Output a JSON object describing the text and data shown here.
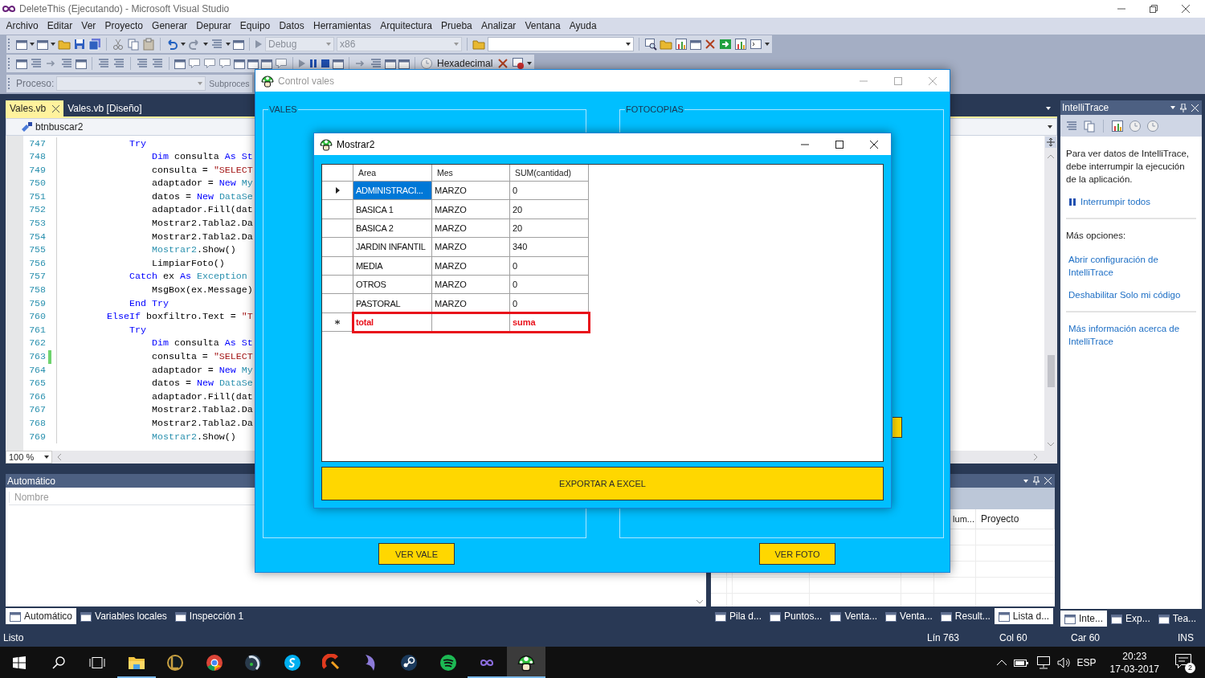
{
  "window": {
    "title": "DeleteThis (Ejecutando) - Microsoft Visual Studio"
  },
  "menu": [
    "Archivo",
    "Editar",
    "Ver",
    "Proyecto",
    "Generar",
    "Depurar",
    "Equipo",
    "Datos",
    "Herramientas",
    "Arquitectura",
    "Prueba",
    "Analizar",
    "Ventana",
    "Ayuda"
  ],
  "toolbar": {
    "configuration": "Debug",
    "platform": "x86",
    "display_format": "Hexadecimal"
  },
  "debug_location": {
    "process_label": "Proceso:",
    "thread_label": "Subproces"
  },
  "editor": {
    "tabs": [
      {
        "label": "Vales.vb",
        "selected": true
      },
      {
        "label": "Vales.vb [Diseño]",
        "selected": false
      }
    ],
    "member": "btnbuscar2",
    "lines": [
      {
        "number": "747",
        "modified": false,
        "tokens": [
          {
            "text": "            Try",
            "kind": "keyword"
          }
        ]
      },
      {
        "number": "748",
        "modified": false,
        "tokens": [
          {
            "text": "                Dim",
            "kind": "keyword"
          },
          {
            "text": " consulta ",
            "kind": "plain"
          },
          {
            "text": "As St",
            "kind": "keyword"
          }
        ]
      },
      {
        "number": "749",
        "modified": false,
        "tokens": [
          {
            "text": "                consulta = ",
            "kind": "plain"
          },
          {
            "text": "\"SELECT",
            "kind": "string"
          }
        ]
      },
      {
        "number": "750",
        "modified": false,
        "tokens": [
          {
            "text": "                adaptador = ",
            "kind": "plain"
          },
          {
            "text": "New ",
            "kind": "keyword"
          },
          {
            "text": "My",
            "kind": "type"
          }
        ]
      },
      {
        "number": "751",
        "modified": false,
        "tokens": [
          {
            "text": "                datos = ",
            "kind": "plain"
          },
          {
            "text": "New ",
            "kind": "keyword"
          },
          {
            "text": "DataSe",
            "kind": "type"
          }
        ]
      },
      {
        "number": "752",
        "modified": false,
        "tokens": [
          {
            "text": "                adaptador.Fill(dat",
            "kind": "plain"
          }
        ]
      },
      {
        "number": "753",
        "modified": false,
        "tokens": [
          {
            "text": "                Mostrar2.Tabla2.Da",
            "kind": "plain"
          }
        ]
      },
      {
        "number": "754",
        "modified": false,
        "tokens": [
          {
            "text": "                Mostrar2.Tabla2.Da",
            "kind": "plain"
          }
        ]
      },
      {
        "number": "755",
        "modified": false,
        "tokens": [
          {
            "text": "                Mostrar2",
            "kind": "type"
          },
          {
            "text": ".Show()",
            "kind": "plain"
          }
        ]
      },
      {
        "number": "756",
        "modified": false,
        "tokens": [
          {
            "text": "                LimpiarFoto()",
            "kind": "plain"
          }
        ]
      },
      {
        "number": "757",
        "modified": false,
        "tokens": [
          {
            "text": "            Catch",
            "kind": "keyword"
          },
          {
            "text": " ex ",
            "kind": "plain"
          },
          {
            "text": "As ",
            "kind": "keyword"
          },
          {
            "text": "Exception",
            "kind": "type"
          }
        ]
      },
      {
        "number": "758",
        "modified": false,
        "tokens": [
          {
            "text": "                MsgBox(ex.Message)",
            "kind": "plain"
          }
        ]
      },
      {
        "number": "759",
        "modified": false,
        "tokens": [
          {
            "text": "            End Try",
            "kind": "keyword"
          }
        ]
      },
      {
        "number": "760",
        "modified": false,
        "tokens": [
          {
            "text": "        ElseIf",
            "kind": "keyword"
          },
          {
            "text": " boxfiltro.Text = ",
            "kind": "plain"
          },
          {
            "text": "\"T",
            "kind": "string"
          }
        ]
      },
      {
        "number": "761",
        "modified": false,
        "tokens": [
          {
            "text": "            Try",
            "kind": "keyword"
          }
        ]
      },
      {
        "number": "762",
        "modified": false,
        "tokens": [
          {
            "text": "                Dim",
            "kind": "keyword"
          },
          {
            "text": " consulta ",
            "kind": "plain"
          },
          {
            "text": "As St",
            "kind": "keyword"
          }
        ]
      },
      {
        "number": "763",
        "modified": true,
        "tokens": [
          {
            "text": "                consulta = ",
            "kind": "plain"
          },
          {
            "text": "\"SELECT",
            "kind": "string"
          }
        ]
      },
      {
        "number": "764",
        "modified": false,
        "tokens": [
          {
            "text": "                adaptador = ",
            "kind": "plain"
          },
          {
            "text": "New ",
            "kind": "keyword"
          },
          {
            "text": "My",
            "kind": "type"
          }
        ]
      },
      {
        "number": "765",
        "modified": false,
        "tokens": [
          {
            "text": "                datos = ",
            "kind": "plain"
          },
          {
            "text": "New ",
            "kind": "keyword"
          },
          {
            "text": "DataSe",
            "kind": "type"
          }
        ]
      },
      {
        "number": "766",
        "modified": false,
        "tokens": [
          {
            "text": "                adaptador.Fill(dat",
            "kind": "plain"
          }
        ]
      },
      {
        "number": "767",
        "modified": false,
        "tokens": [
          {
            "text": "                Mostrar2.Tabla2.Da",
            "kind": "plain"
          }
        ]
      },
      {
        "number": "768",
        "modified": false,
        "tokens": [
          {
            "text": "                Mostrar2.Tabla2.Da",
            "kind": "plain"
          }
        ]
      },
      {
        "number": "769",
        "modified": false,
        "tokens": [
          {
            "text": "                Mostrar2",
            "kind": "type"
          },
          {
            "text": ".Show()",
            "kind": "plain"
          }
        ]
      }
    ],
    "zoom": "100 %"
  },
  "intellitrace": {
    "title": "IntelliTrace",
    "message": "Para ver datos de IntelliTrace, debe interrumpir la ejecución de la aplicación.",
    "break_link": "Interrumpir todos",
    "more_label": "Más opciones:",
    "links": [
      "Abrir configuración de IntelliTrace",
      "Deshabilitar Solo mi código"
    ],
    "info_link": "Más información acerca de IntelliTrace",
    "tabs": [
      {
        "label": "Inte...",
        "selected": true
      },
      {
        "label": "Exp...",
        "selected": false
      },
      {
        "label": "Tea...",
        "selected": false
      }
    ]
  },
  "autos": {
    "title": "Automático",
    "column": "Nombre",
    "tabs": [
      {
        "label": "Automático",
        "selected": true
      },
      {
        "label": "Variables locales",
        "selected": false
      },
      {
        "label": "Inspección 1",
        "selected": false
      }
    ]
  },
  "error_list": {
    "columns": [
      "lum...",
      "Proyecto"
    ],
    "tabs": [
      {
        "label": "Pila d...",
        "selected": false
      },
      {
        "label": "Puntos...",
        "selected": false
      },
      {
        "label": "Venta...",
        "selected": false
      },
      {
        "label": "Venta...",
        "selected": false
      },
      {
        "label": "Result...",
        "selected": false
      },
      {
        "label": "Lista d...",
        "selected": true
      }
    ]
  },
  "status_bar": {
    "message": "Listo",
    "line": "Lín 763",
    "column": "Col 60",
    "char": "Car 60",
    "mode": "INS"
  },
  "taskbar": {
    "apps": [
      {
        "kind": "explorer",
        "running": true,
        "selected": false
      },
      {
        "kind": "game",
        "running": false,
        "selected": false
      },
      {
        "kind": "browser",
        "running": false,
        "selected": false
      },
      {
        "kind": "media",
        "running": false,
        "selected": false
      },
      {
        "kind": "chat",
        "running": false,
        "selected": false
      },
      {
        "kind": "cleaner",
        "running": false,
        "selected": false
      },
      {
        "kind": "dolphin",
        "running": false,
        "selected": false
      },
      {
        "kind": "steam",
        "running": false,
        "selected": false
      },
      {
        "kind": "music",
        "running": false,
        "selected": false
      },
      {
        "kind": "studio",
        "running": true,
        "selected": false
      },
      {
        "kind": "mushroom",
        "running": true,
        "selected": true
      }
    ],
    "language": "ESP",
    "time": "20:23",
    "date": "17-03-2017",
    "notifications": "2"
  },
  "control_vales": {
    "title": "Control vales",
    "groups": [
      {
        "title": "VALES",
        "button": "VER VALE"
      },
      {
        "title": "FOTOCOPIAS",
        "button": "VER FOTO"
      }
    ]
  },
  "mostrar2": {
    "title": "Mostrar2",
    "columns": [
      "Area",
      "Mes",
      "SUM(cantidad)"
    ],
    "rows": [
      {
        "area": "ADMINISTRACI...",
        "mes": "MARZO",
        "sum": "0",
        "current": true,
        "selected": true,
        "new_row": false,
        "highlighted": false
      },
      {
        "area": "BASICA 1",
        "mes": "MARZO",
        "sum": "20",
        "current": false,
        "selected": false,
        "new_row": false,
        "highlighted": false
      },
      {
        "area": "BASICA 2",
        "mes": "MARZO",
        "sum": "20",
        "current": false,
        "selected": false,
        "new_row": false,
        "highlighted": false
      },
      {
        "area": "JARDIN INFANTIL",
        "mes": "MARZO",
        "sum": "340",
        "current": false,
        "selected": false,
        "new_row": false,
        "highlighted": false
      },
      {
        "area": "MEDIA",
        "mes": "MARZO",
        "sum": "0",
        "current": false,
        "selected": false,
        "new_row": false,
        "highlighted": false
      },
      {
        "area": "OTROS",
        "mes": "MARZO",
        "sum": "0",
        "current": false,
        "selected": false,
        "new_row": false,
        "highlighted": false
      },
      {
        "area": "PASTORAL",
        "mes": "MARZO",
        "sum": "0",
        "current": false,
        "selected": false,
        "new_row": false,
        "highlighted": false
      },
      {
        "area": "total",
        "sum": "suma",
        "current": false,
        "selected": false,
        "new_row": true,
        "highlighted": true
      }
    ],
    "export_button": "EXPORTAR A EXCEL"
  }
}
